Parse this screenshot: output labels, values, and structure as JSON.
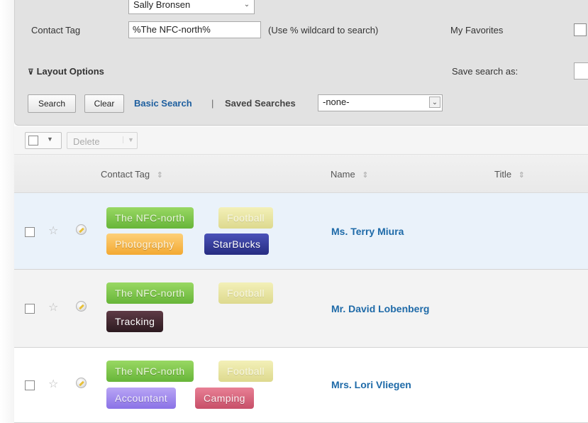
{
  "search_form": {
    "assigned_user_value": "Sally Bronsen",
    "contact_tag_label": "Contact Tag",
    "contact_tag_value": "%The NFC-north%",
    "wildcard_hint": "(Use % wildcard to search)",
    "my_favorites_label": "My Favorites",
    "layout_options_label": "Layout Options",
    "save_search_label": "Save search as:",
    "search_button": "Search",
    "clear_button": "Clear",
    "basic_search_link": "Basic Search",
    "separator": "|",
    "saved_searches_label": "Saved Searches",
    "saved_searches_value": "-none-"
  },
  "toolbar": {
    "delete_label": "Delete"
  },
  "table": {
    "columns": [
      "Contact Tag",
      "Name",
      "Title"
    ],
    "rows": [
      {
        "name": "Ms. Terry Miura",
        "tags": [
          "The NFC-north",
          "Football",
          "Photography",
          "StarBucks"
        ]
      },
      {
        "name": "Mr. David Lobenberg",
        "tags": [
          "The NFC-north",
          "Football",
          "Tracking"
        ]
      },
      {
        "name": "Mrs. Lori Vliegen",
        "tags": [
          "The NFC-north",
          "Football",
          "Accountant",
          "Camping"
        ]
      }
    ]
  },
  "icons": {
    "sort": "sort-icon",
    "favorite": "star-icon",
    "edit": "pencil-icon",
    "layout_toggle": "double-chevron-down-icon",
    "dropdown": "chevron-down-icon"
  },
  "colors": {
    "link": "#1e6aa8",
    "panel_bg": "#e2e2e2",
    "selected_row_bg": "#eaf2fa"
  }
}
